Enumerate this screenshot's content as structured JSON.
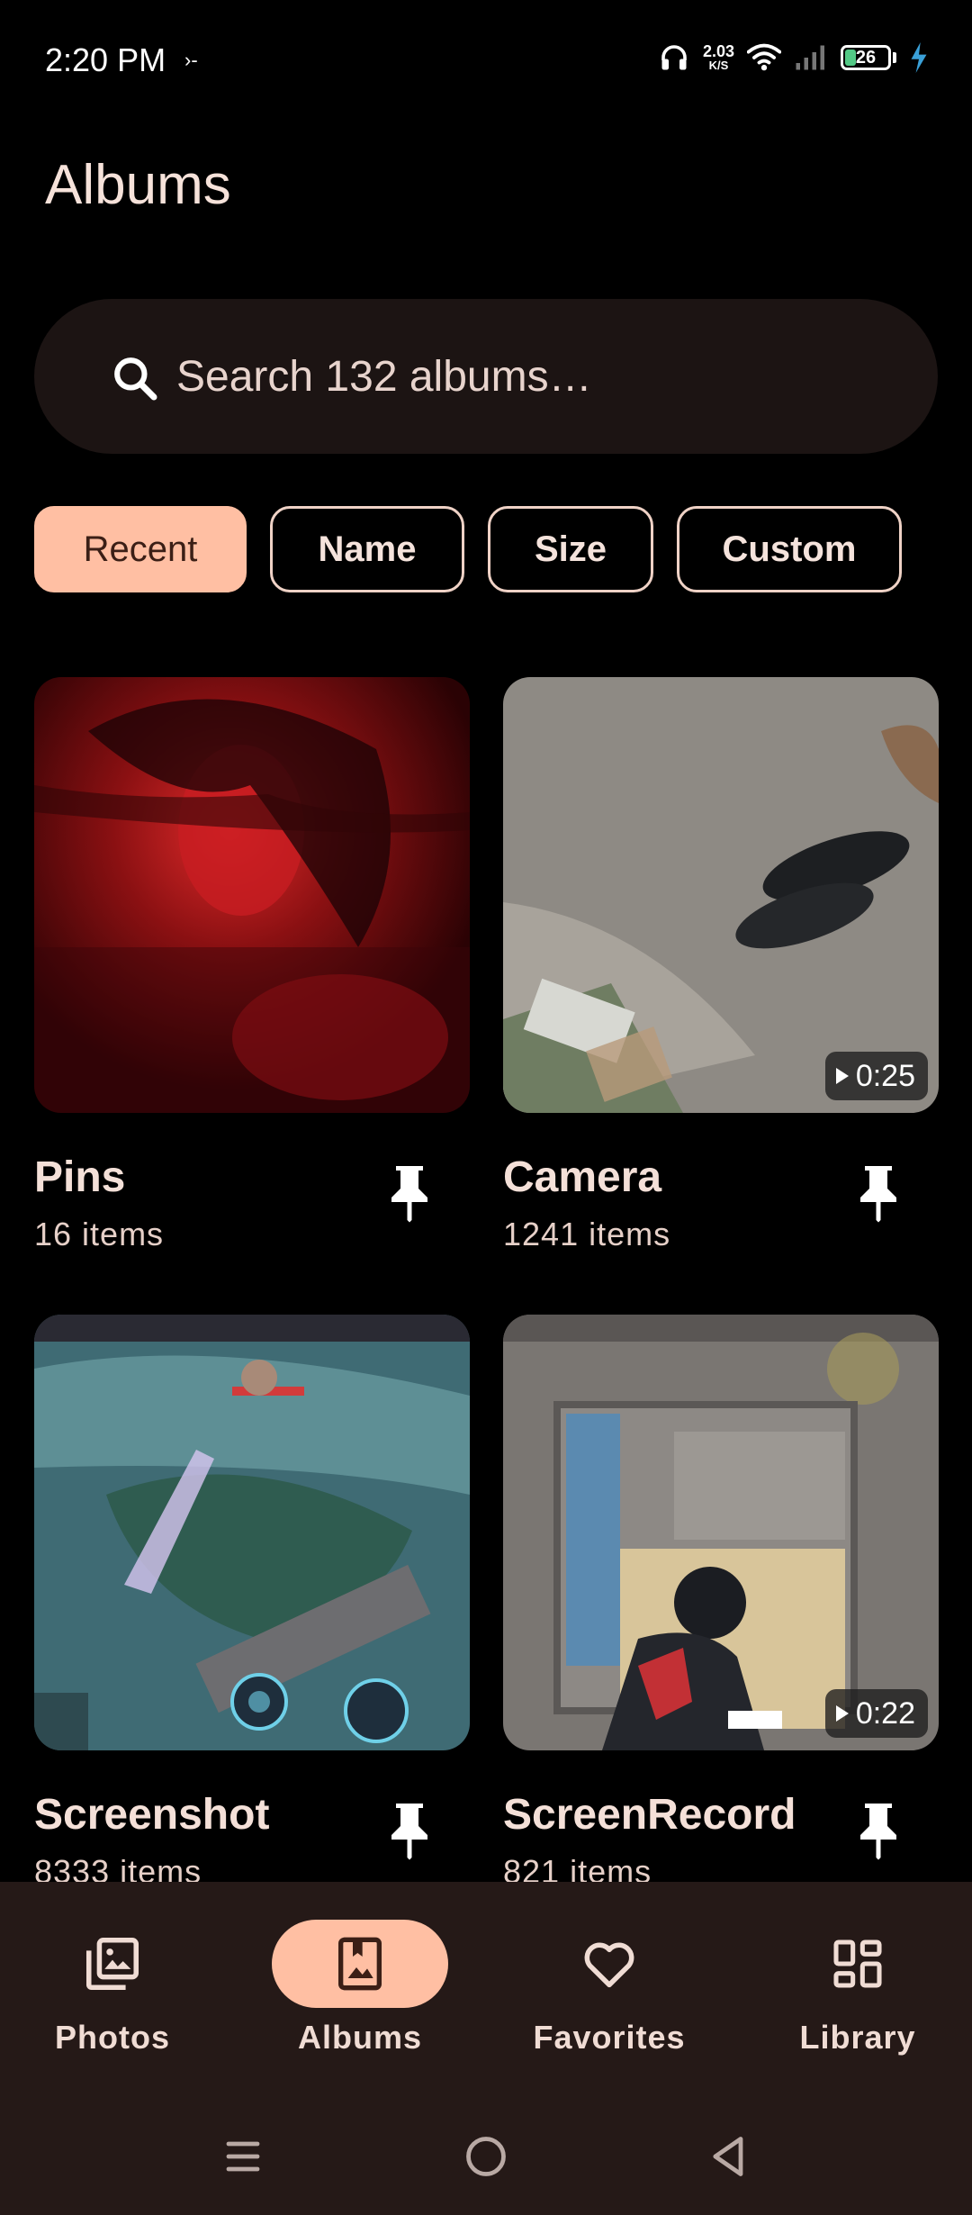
{
  "status_bar": {
    "time": "2:20 PM",
    "extra_indicator": "›-",
    "net_speed_value": "2.03",
    "net_speed_unit": "K/S",
    "battery_level": "26"
  },
  "header": {
    "title": "Albums"
  },
  "search": {
    "placeholder": "Search 132 albums…"
  },
  "sort_chips": [
    {
      "label": "Recent",
      "active": true
    },
    {
      "label": "Name",
      "active": false
    },
    {
      "label": "Size",
      "active": false
    },
    {
      "label": "Custom",
      "active": false
    }
  ],
  "albums": [
    {
      "name": "Pins",
      "count": "16 items",
      "thumbnail": "red-blurred-portrait",
      "duration": null
    },
    {
      "name": "Camera",
      "count": "1241 items",
      "thumbnail": "slippers-on-floor",
      "duration": "0:25"
    },
    {
      "name": "Screenshot",
      "count": "8333 items",
      "thumbnail": "moba-game-screenshot",
      "duration": null
    },
    {
      "name": "ScreenRecord",
      "count": "821 items",
      "thumbnail": "shooter-game-recording",
      "duration": "0:22"
    }
  ],
  "bottom_nav": [
    {
      "label": "Photos",
      "icon": "photos-icon",
      "active": false
    },
    {
      "label": "Albums",
      "icon": "album-icon",
      "active": true
    },
    {
      "label": "Favorites",
      "icon": "heart-icon",
      "active": false
    },
    {
      "label": "Library",
      "icon": "library-icon",
      "active": false
    }
  ],
  "colors": {
    "background": "#000000",
    "accent": "#ffbfa3",
    "nav_background": "#251917",
    "search_background": "#1c1413",
    "text": "#f3e1da"
  }
}
